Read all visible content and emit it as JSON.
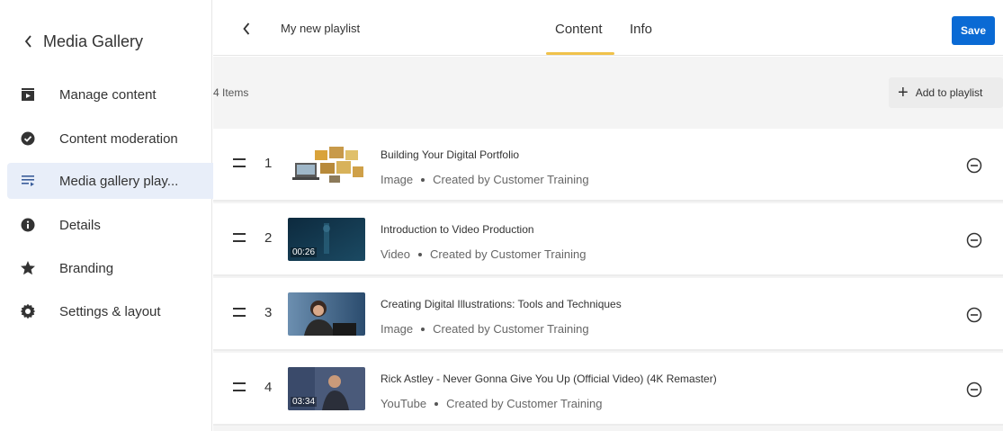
{
  "sidebar": {
    "title": "Media Gallery",
    "items": [
      {
        "label": "Manage content",
        "icon": "media-icon"
      },
      {
        "label": "Content moderation",
        "icon": "check-circle-icon"
      },
      {
        "label": "Media gallery play...",
        "icon": "playlist-icon"
      },
      {
        "label": "Details",
        "icon": "info-icon"
      },
      {
        "label": "Branding",
        "icon": "star-icon"
      },
      {
        "label": "Settings & layout",
        "icon": "gear-icon"
      }
    ]
  },
  "header": {
    "playlist_name": "My new playlist",
    "tabs": [
      {
        "label": "Content"
      },
      {
        "label": "Info"
      }
    ],
    "active_tab": "Content",
    "save_label": "Save"
  },
  "content": {
    "items_count": "4 Items",
    "add_label": "Add to playlist",
    "rows": [
      {
        "index": "1",
        "title": "Building Your Digital Portfolio",
        "type": "Image",
        "creator": "Created by Customer Training",
        "duration": ""
      },
      {
        "index": "2",
        "title": "Introduction to Video Production",
        "type": "Video",
        "creator": "Created by Customer Training",
        "duration": "00:26"
      },
      {
        "index": "3",
        "title": "Creating Digital Illustrations: Tools and Techniques",
        "type": "Image",
        "creator": "Created by Customer Training",
        "duration": ""
      },
      {
        "index": "4",
        "title": "Rick Astley - Never Gonna Give You Up (Official Video) (4K Remaster)",
        "type": "YouTube",
        "creator": "Created by Customer Training",
        "duration": "03:34"
      }
    ]
  },
  "colors": {
    "accent": "#0a6ad4",
    "active_tab_underline": "#f0c24b",
    "active_sidebar_bg": "#e8eef9"
  }
}
